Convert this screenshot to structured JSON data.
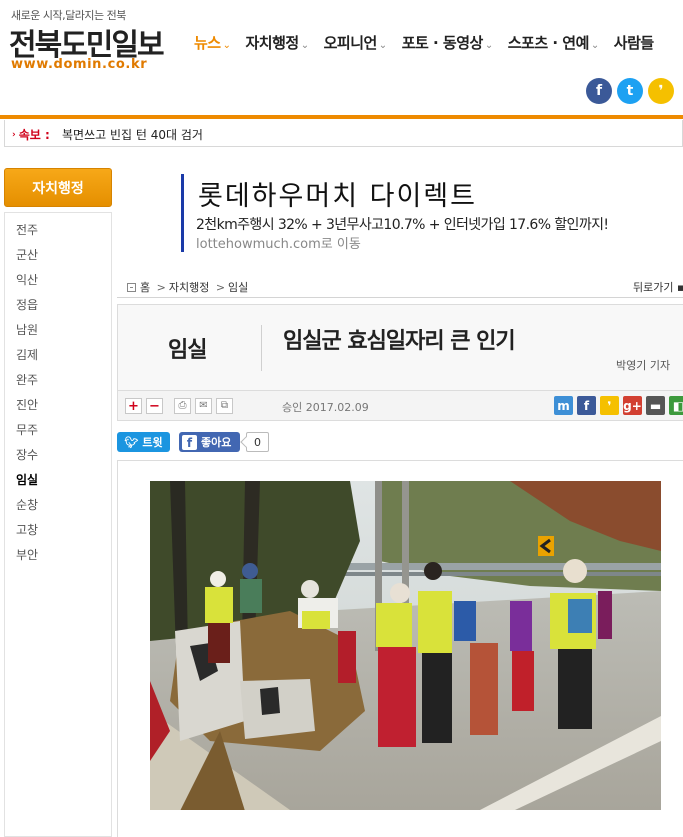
{
  "header": {
    "tagline": "새로운 시작,달라지는 전북",
    "site_name": "전북도민일보",
    "url": "www.domin.co.kr",
    "nav": [
      {
        "label": "뉴스",
        "active": true
      },
      {
        "label": "자치행정",
        "active": false
      },
      {
        "label": "오피니언",
        "active": false
      },
      {
        "label": "포토 · 동영상",
        "active": false
      },
      {
        "label": "스포츠 · 연예",
        "active": false
      },
      {
        "label": "사람들",
        "active": false
      }
    ],
    "social": [
      {
        "icon": "facebook-icon",
        "glyph": "f",
        "color": "#3b5998"
      },
      {
        "icon": "twitter-icon",
        "glyph": "t",
        "color": "#1da1f2"
      },
      {
        "icon": "kakaostory-icon",
        "glyph": "❜",
        "color": "#f5c000"
      }
    ],
    "accent_color": "#ee8a00"
  },
  "breaking": {
    "label": "속보 :",
    "text": "복면쓰고 빈집 턴 40대 검거"
  },
  "sidebar": {
    "title": "자치행정",
    "items": [
      {
        "label": "전주",
        "active": false
      },
      {
        "label": "군산",
        "active": false
      },
      {
        "label": "익산",
        "active": false
      },
      {
        "label": "정읍",
        "active": false
      },
      {
        "label": "남원",
        "active": false
      },
      {
        "label": "김제",
        "active": false
      },
      {
        "label": "완주",
        "active": false
      },
      {
        "label": "진안",
        "active": false
      },
      {
        "label": "무주",
        "active": false
      },
      {
        "label": "장수",
        "active": false
      },
      {
        "label": "임실",
        "active": true
      },
      {
        "label": "순창",
        "active": false
      },
      {
        "label": "고창",
        "active": false
      },
      {
        "label": "부안",
        "active": false
      }
    ]
  },
  "ad": {
    "title": "롯데하우머치 다이렉트",
    "subtitle": "2천km주행시 32% + 3년무사고10.7% + 인터넷가입 17.6% 할인까지!",
    "link": "lottehowmuch.com로 이동"
  },
  "breadcrumb": {
    "home": "홈",
    "section": "자치행정",
    "current": "임실",
    "sep": ">",
    "back": "뒤로가기 ▪"
  },
  "article": {
    "category": "임실",
    "title": "임실군 효심일자리 큰 인기",
    "reporter": "박영기 기자",
    "approved": "승인 2017.02.09"
  },
  "toolbar": {
    "font_up": "+",
    "font_down": "−",
    "print": "⎙",
    "email": "✉",
    "copy": "⧉"
  },
  "share_buttons": [
    {
      "icon": "me2day-icon",
      "glyph": "m",
      "color": "#3d8fd6"
    },
    {
      "icon": "facebook-icon",
      "glyph": "f",
      "color": "#3b5998"
    },
    {
      "icon": "kakaostory-icon",
      "glyph": "❜",
      "color": "#f5c000"
    },
    {
      "icon": "googleplus-icon",
      "glyph": "g+",
      "color": "#d23f31"
    },
    {
      "icon": "band-icon",
      "glyph": "▬",
      "color": "#555"
    },
    {
      "icon": "delicious-icon",
      "glyph": "◧",
      "color": "#3d9a3d"
    }
  ],
  "social_actions": {
    "tweet": "트윗",
    "like": "좋아요",
    "like_count": "0"
  }
}
